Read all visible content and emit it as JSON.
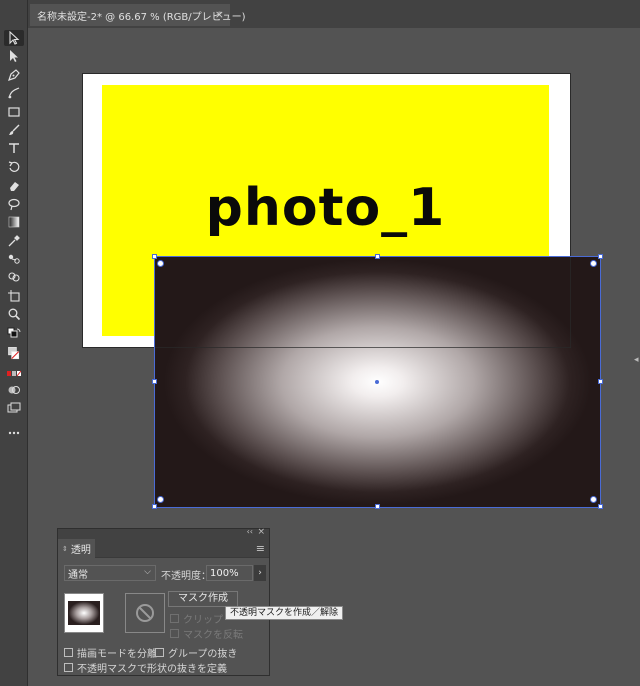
{
  "document_tab": {
    "title": "名称未設定-2* @ 66.67 % (RGB/プレビュー)",
    "close_glyph": "×"
  },
  "canvas": {
    "artboard_text": "photo_1"
  },
  "transparency_panel": {
    "tab_label": "透明",
    "tab_arrows": "⇕",
    "collapse_glyph": "‹‹",
    "close_glyph": "×",
    "menu_glyph": "≡",
    "blend_mode": "通常",
    "opacity_label": "不透明度：",
    "opacity_value": "100%",
    "opacity_arrow": "›",
    "make_mask_label": "マスク作成",
    "clip_label": "クリップ",
    "invert_mask_label": "マスクを反転",
    "isolate_blending_label": "描画モードを分離",
    "knockout_group_label": "グループの抜き",
    "opacity_mask_knockout_label": "不透明マスクで形状の抜きを定義"
  },
  "tooltip": {
    "text": "不透明マスクを作成／解除"
  },
  "colors": {
    "selection": "#4a6bd6",
    "artboard_fill": "#ffff00"
  },
  "icons": [
    "selection-tool-icon",
    "direct-selection-icon",
    "pen-icon",
    "curvature-icon",
    "rectangle-icon",
    "paintbrush-icon",
    "type-icon",
    "rotate-icon",
    "eraser-icon",
    "lasso-icon",
    "gradient-icon",
    "eyedropper-icon",
    "blend-icon",
    "shape-builder-icon",
    "artboard-icon",
    "zoom-icon",
    "no-mask-icon"
  ]
}
